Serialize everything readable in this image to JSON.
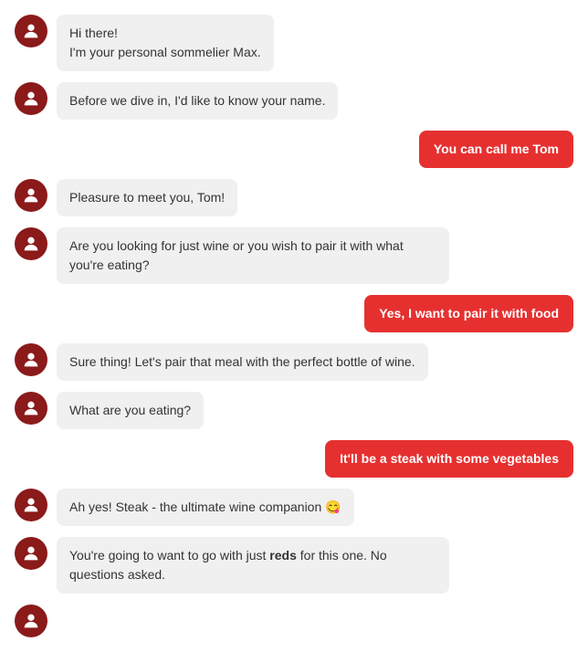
{
  "messages": [
    {
      "id": "msg1",
      "type": "bot",
      "lines": [
        "Hi there!",
        "I'm your personal sommelier Max."
      ]
    },
    {
      "id": "msg2",
      "type": "bot",
      "lines": [
        "Before we dive in, I'd like to know your name."
      ]
    },
    {
      "id": "msg3",
      "type": "user",
      "lines": [
        "You can call me Tom"
      ]
    },
    {
      "id": "msg4",
      "type": "bot",
      "lines": [
        "Pleasure to meet you, Tom!"
      ]
    },
    {
      "id": "msg5",
      "type": "bot",
      "lines": [
        "Are you looking for just wine or you wish to pair it with what you're eating?"
      ]
    },
    {
      "id": "msg6",
      "type": "user",
      "lines": [
        "Yes, I want to pair it with food"
      ]
    },
    {
      "id": "msg7",
      "type": "bot",
      "lines": [
        "Sure thing! Let's pair that meal with the perfect bottle of wine."
      ]
    },
    {
      "id": "msg8",
      "type": "bot",
      "lines": [
        "What are you eating?"
      ]
    },
    {
      "id": "msg9",
      "type": "user",
      "lines": [
        "It'll be a steak with some vegetables"
      ]
    },
    {
      "id": "msg10",
      "type": "bot",
      "lines": [
        "Ah yes! Steak - the ultimate wine companion 😋"
      ]
    },
    {
      "id": "msg11",
      "type": "bot",
      "lines": [
        "You're going to want to go with just <strong>reds</strong> for this one. No questions asked."
      ]
    },
    {
      "id": "msg12",
      "type": "bot",
      "lines": [
        ""
      ]
    }
  ],
  "colors": {
    "accent": "#e63030",
    "avatar_bg": "#8b1a1a",
    "bubble_bot": "#f0f0f0",
    "bubble_user": "#e63030"
  }
}
